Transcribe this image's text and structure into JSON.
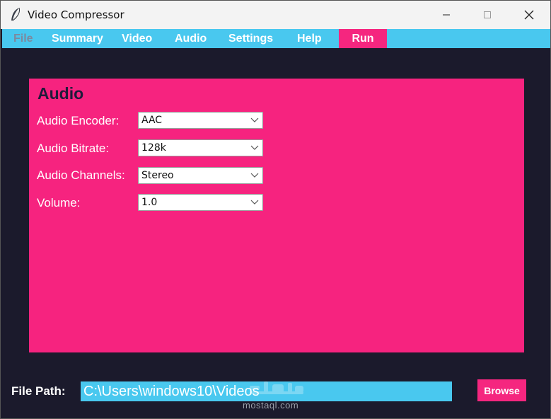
{
  "window": {
    "title": "Video Compressor"
  },
  "menubar": {
    "items": [
      {
        "label": "File"
      },
      {
        "label": "Summary"
      },
      {
        "label": "Video"
      },
      {
        "label": "Audio"
      },
      {
        "label": "Settings"
      },
      {
        "label": "Help"
      },
      {
        "label": "Run"
      }
    ]
  },
  "panel": {
    "title": "Audio",
    "fields": [
      {
        "label": "Audio Encoder:",
        "value": "AAC"
      },
      {
        "label": "Audio Bitrate:",
        "value": "128k"
      },
      {
        "label": "Audio Channels:",
        "value": "Stereo"
      },
      {
        "label": "Volume:",
        "value": "1.0"
      }
    ]
  },
  "file_path": {
    "label": "File Path:",
    "value": "C:\\Users\\windows10\\Videos",
    "browse_label": "Browse"
  },
  "watermark": {
    "text": "mostaql.com"
  },
  "colors": {
    "accent_pink": "#f6237f",
    "menubar_cyan": "#49c8ef",
    "background_dark": "#1b1a2c"
  },
  "icons": [
    "feather-icon",
    "minimize-icon",
    "maximize-icon",
    "close-icon",
    "chevron-down-icon"
  ]
}
